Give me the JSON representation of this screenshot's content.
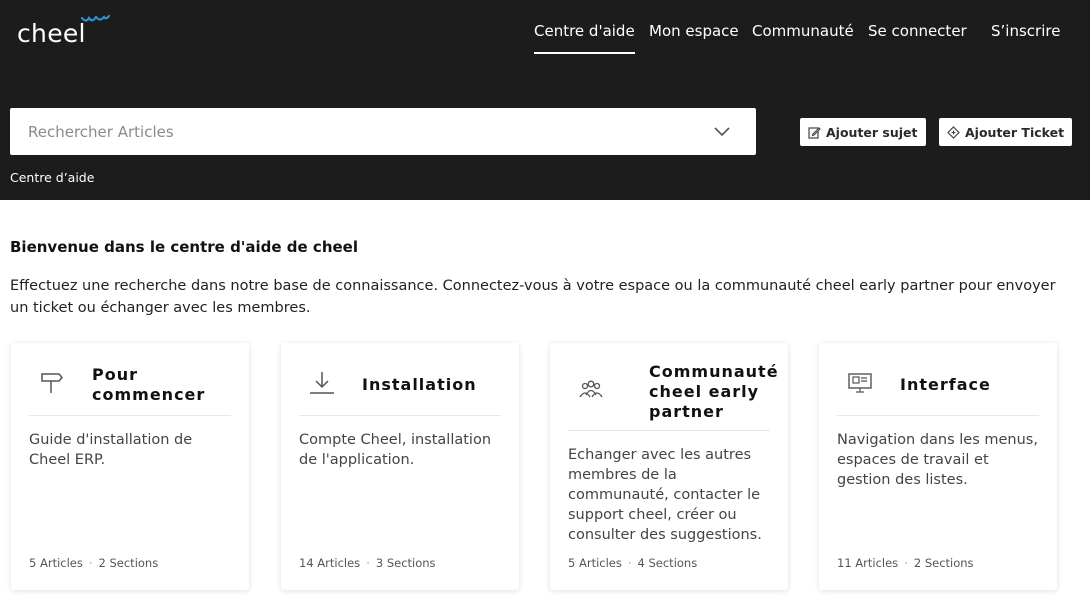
{
  "header": {
    "logo": "cheel",
    "nav": [
      {
        "label": "Centre d'aide",
        "active": true
      },
      {
        "label": "Mon espace",
        "active": false
      },
      {
        "label": "Communauté",
        "active": false
      },
      {
        "label": "Se connecter",
        "active": false
      },
      {
        "label": "S’inscrire",
        "active": false
      }
    ],
    "search": {
      "placeholder": "Rechercher Articles"
    },
    "add_topic_label": "Ajouter sujet",
    "add_ticket_label": "Ajouter Ticket",
    "breadcrumb": "Centre d’aide"
  },
  "welcome": {
    "title": "Bienvenue dans le centre d'aide de cheel",
    "text": "Effectuez une recherche dans notre base de connaissance. Connectez-vous à votre espace ou la communauté cheel early partner pour envoyer un ticket ou échanger avec les membres."
  },
  "categories": [
    {
      "icon": "signpost-icon",
      "title": "Pour commencer",
      "description": "Guide d'installation de Cheel ERP.",
      "articles": "5 Articles",
      "sections": "2 Sections"
    },
    {
      "icon": "download-icon",
      "title": "Installation",
      "description": "Compte Cheel, installation de l'application.",
      "articles": "14 Articles",
      "sections": "3 Sections"
    },
    {
      "icon": "community-icon",
      "title": "Communauté cheel early partner",
      "description": "Echanger avec les autres membres de la communauté, contacter le support cheel, créer ou consulter des suggestions.",
      "articles": "5 Articles",
      "sections": "4 Sections"
    },
    {
      "icon": "monitor-icon",
      "title": "Interface",
      "description": "Navigation dans les menus, espaces de travail et gestion des listes.",
      "articles": "11 Articles",
      "sections": "2 Sections"
    }
  ],
  "colors": {
    "header_bg": "#1c1c1c",
    "logo_accent": "#2f8fd0"
  }
}
